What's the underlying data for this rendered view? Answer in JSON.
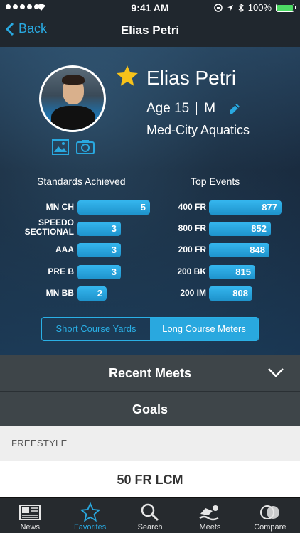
{
  "status_bar": {
    "time": "9:41 AM",
    "battery": "100%"
  },
  "nav": {
    "back_label": "Back",
    "title": "Elias Petri"
  },
  "profile": {
    "name": "Elias Petri",
    "age": "Age 15",
    "sex": "M",
    "team": "Med-City Aquatics"
  },
  "standards": {
    "title": "Standards Achieved",
    "rows": [
      {
        "label": "MN CH",
        "value": 5
      },
      {
        "label": "SPEEDO SECTIONAL",
        "value": 3
      },
      {
        "label": "AAA",
        "value": 3
      },
      {
        "label": "PRE B",
        "value": 3
      },
      {
        "label": "MN BB",
        "value": 2
      }
    ]
  },
  "top_events": {
    "title": "Top Events",
    "rows": [
      {
        "label": "400 FR",
        "value": 877
      },
      {
        "label": "800 FR",
        "value": 852
      },
      {
        "label": "200 FR",
        "value": 848
      },
      {
        "label": "200 BK",
        "value": 815
      },
      {
        "label": "200 IM",
        "value": 808
      }
    ]
  },
  "course_toggle": {
    "options": [
      "Short Course Yards",
      "Long Course Meters"
    ],
    "selected": "Long Course Meters"
  },
  "sections": {
    "recent_meets": "Recent Meets",
    "goals": "Goals"
  },
  "stroke_header": "FREESTYLE",
  "goal_event": "50 FR LCM",
  "tabs": [
    {
      "label": "News",
      "icon": "newspaper-icon"
    },
    {
      "label": "Favorites",
      "icon": "star-icon",
      "active": true
    },
    {
      "label": "Search",
      "icon": "search-icon"
    },
    {
      "label": "Meets",
      "icon": "swimmer-icon"
    },
    {
      "label": "Compare",
      "icon": "compare-icon"
    }
  ],
  "colors": {
    "accent": "#29a8df",
    "star": "#f7c21a",
    "bar": "#2aa4dd",
    "section_bg": "#3e4549"
  }
}
